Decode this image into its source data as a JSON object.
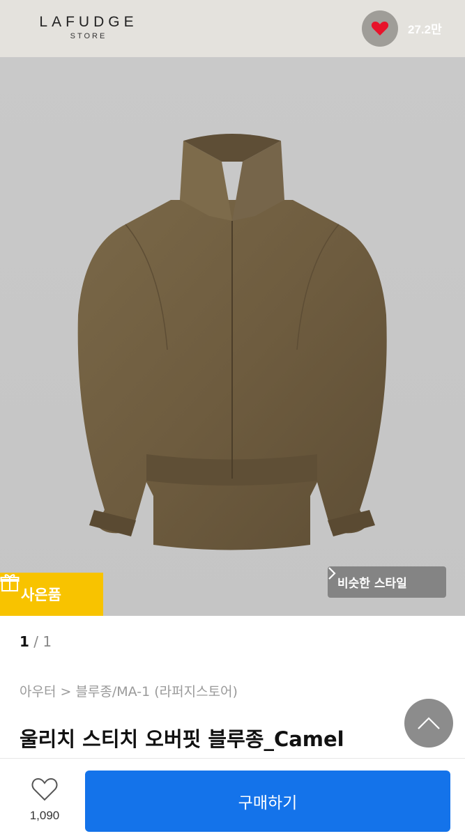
{
  "header": {
    "logo_main": "LAFUDGE",
    "logo_sub": "STORE",
    "store_like_count": "27.2만",
    "heart_color": "#e8132a"
  },
  "product_image": {
    "gift_badge_label": "사은품",
    "similar_style_label": "비슷한 스타일",
    "badge_color": "#f8c300"
  },
  "pager": {
    "current": "1",
    "separator": "/",
    "total": "1"
  },
  "breadcrumb": "아우터 > 블루종/MA-1 (라퍼지스토어)",
  "product": {
    "title": "울리치 스티치 오버핏 블루종_Camel"
  },
  "bottom_bar": {
    "like_count": "1,090",
    "buy_label": "구매하기",
    "buy_color": "#1473ea"
  },
  "icons": [
    "heart-icon",
    "gift-icon",
    "chevron-right-icon",
    "chevron-up-icon",
    "heart-outline-icon"
  ]
}
